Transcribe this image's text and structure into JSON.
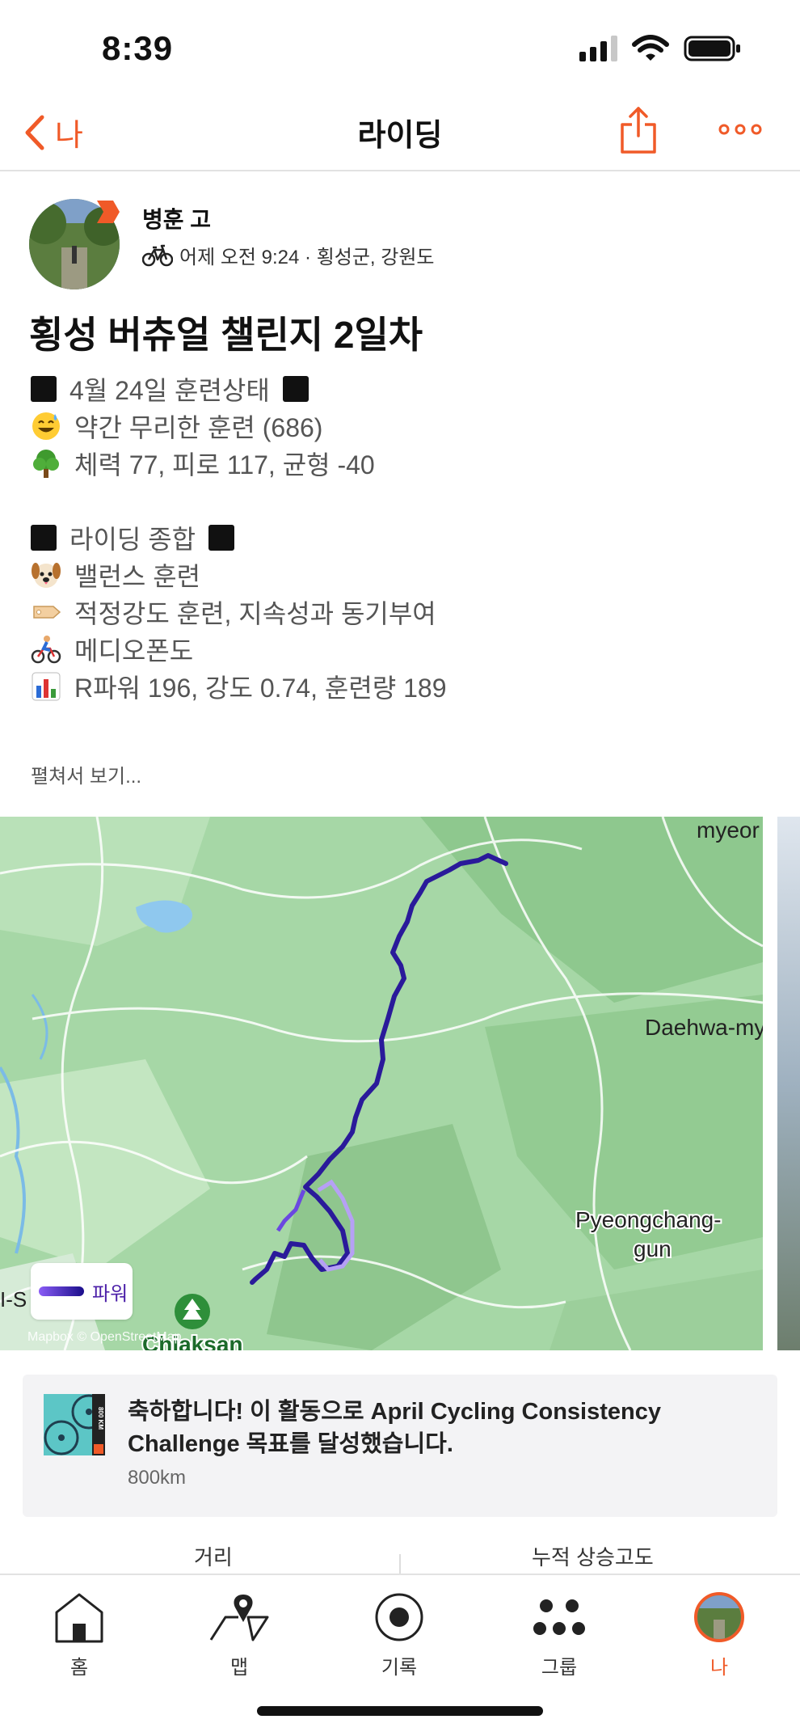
{
  "status_bar": {
    "time": "8:39"
  },
  "nav": {
    "back_label": "나",
    "title": "라이딩"
  },
  "activity": {
    "athlete_name": "병훈 고",
    "meta": "어제 오전 9:24 · 횡성군, 강원도",
    "title": "횡성 버츄얼 챌린지 2일차",
    "description": {
      "section1_header": "4월 24일 훈련상태",
      "line_effort": "약간 무리한 훈련 (686)",
      "line_fitness": "체력 77, 피로 117, 균형 -40",
      "section2_header": "라이딩 종합",
      "line_type": "밸런스 훈련",
      "line_tag": "적정강도 훈련, 지속성과 동기부여",
      "line_zone": "메디오폰도",
      "line_power": "R파워 196, 강도 0.74, 훈련량 189"
    },
    "read_more": "펼쳐서 보기..."
  },
  "map": {
    "labels": {
      "top_right": "myeor",
      "right_mid": "Daehwa-my",
      "pyeongchang_1": "Pyeongchang-",
      "pyeongchang_2": "gun",
      "left_edge": "I-S",
      "chiaksan": "Chiaksan",
      "attribution": "Mapbox © OpenStreetMap"
    },
    "legend_label": "파워",
    "route_color": "#2a1a9a"
  },
  "challenge": {
    "text": "축하합니다! 이 활동으로 April Cycling Consistency Challenge 목표를 달성했습니다.",
    "distance": "800km",
    "badge_text": "800 KM"
  },
  "stats": {
    "distance_label": "거리",
    "elevation_label": "누적 상승고도"
  },
  "tabs": [
    {
      "label": "홈"
    },
    {
      "label": "맵"
    },
    {
      "label": "기록"
    },
    {
      "label": "그룹"
    },
    {
      "label": "나"
    }
  ],
  "colors": {
    "accent": "#f05a28"
  }
}
